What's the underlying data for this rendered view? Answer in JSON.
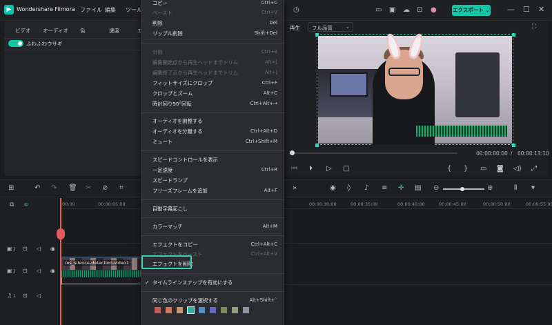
{
  "app": {
    "title": "Wondershare Filmora",
    "export_label": "エクスポート ⌄"
  },
  "menubar": [
    "ファイル",
    "編集",
    "ツール"
  ],
  "left_panel": {
    "tabs": [
      "ビデオ",
      "オーディオ",
      "色",
      "速度",
      "エ"
    ],
    "effect_name": "ふわふわウサギ"
  },
  "preview": {
    "label": "再生",
    "quality": "フル品質",
    "current_time": "00:00:00:00",
    "separator": "/",
    "total_time": "00:00:13:10"
  },
  "timeline": {
    "ruler": [
      "00:00",
      "00:00:05:00",
      "00:00:30:00",
      "00:00:35:00",
      "00:00:40:00",
      "00:00:45:00",
      "00:00:50:00",
      "00:00:55:00"
    ],
    "clip_label": "res_silence-detection-video1",
    "tracks": [
      {
        "num": "2"
      },
      {
        "num": "2"
      },
      {
        "num": "1"
      }
    ]
  },
  "context_menu": {
    "items": [
      {
        "label": "コピー",
        "shortcut": "Ctrl+C",
        "disabled": false
      },
      {
        "label": "ペースト",
        "shortcut": "Ctrl+V",
        "disabled": true
      },
      {
        "label": "削除",
        "shortcut": "Del",
        "disabled": false
      },
      {
        "label": "リップル削除",
        "shortcut": "Shift+Del",
        "disabled": false
      },
      {
        "label": "分割",
        "shortcut": "Ctrl+B",
        "disabled": true
      },
      {
        "label": "編集開始点から再生ヘッドまでトリム",
        "shortcut": "Alt+[",
        "disabled": true
      },
      {
        "label": "編集終了点から再生ヘッドまでトリム",
        "shortcut": "Alt+]",
        "disabled": true
      },
      {
        "label": "フィットサイズにクロップ",
        "shortcut": "Ctrl+F",
        "disabled": false
      },
      {
        "label": "クロップとズーム",
        "shortcut": "Alt+C",
        "disabled": false
      },
      {
        "label": "時計回り90°回転",
        "shortcut": "Ctrl+Alt+→",
        "disabled": false
      },
      {
        "label": "オーディオを調整する",
        "shortcut": "",
        "disabled": false
      },
      {
        "label": "オーディオを分離する",
        "shortcut": "Ctrl+Alt+D",
        "disabled": false
      },
      {
        "label": "ミュート",
        "shortcut": "Ctrl+Shift+M",
        "disabled": false
      },
      {
        "label": "スピードコントロールを表示",
        "shortcut": "",
        "disabled": false
      },
      {
        "label": "一定速度",
        "shortcut": "Ctrl+R",
        "disabled": false
      },
      {
        "label": "スピードランプ",
        "shortcut": "",
        "disabled": false
      },
      {
        "label": "フリーズフレームを追加",
        "shortcut": "Alt+F",
        "disabled": false
      },
      {
        "label": "自動字幕起こし",
        "shortcut": "",
        "disabled": false
      },
      {
        "label": "カラーマッチ",
        "shortcut": "Alt+M",
        "disabled": false
      },
      {
        "label": "エフェクトをコピー",
        "shortcut": "Ctrl+Alt+C",
        "disabled": false
      },
      {
        "label": "エフェクトをペースト",
        "shortcut": "Ctrl+Alt+V",
        "disabled": true
      },
      {
        "label": "エフェクトを削除",
        "shortcut": "",
        "disabled": false
      },
      {
        "label": "タイムラインスナップを有効にする",
        "shortcut": "",
        "disabled": false,
        "checked": true
      },
      {
        "label": "同じ色のクリップを選択する",
        "shortcut": "Alt+Shift+`",
        "disabled": false
      }
    ],
    "colors": [
      "#c65a5a",
      "#d6735a",
      "#c8946a",
      "#2ab4a0",
      "#4e8fc0",
      "#5f6ac0",
      "#7a8a5a",
      "#8fa078",
      "#8e93a8"
    ]
  }
}
